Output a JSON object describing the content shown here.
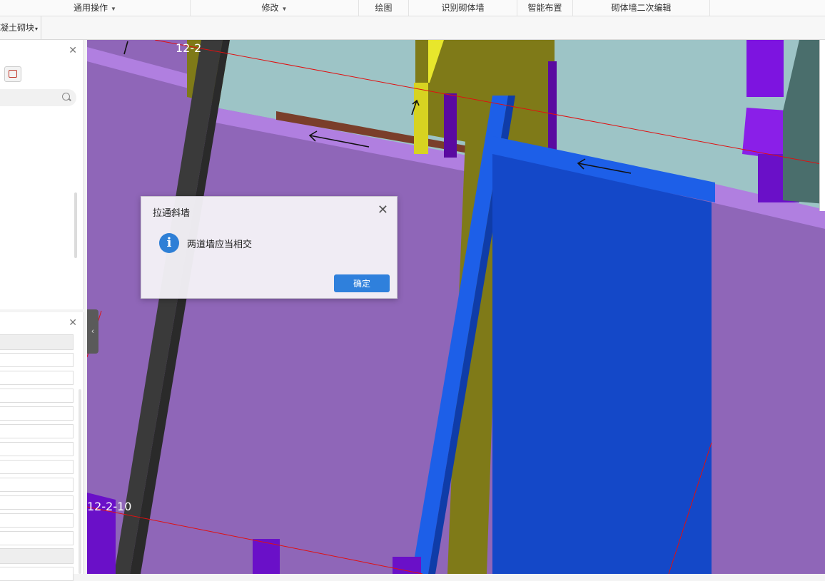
{
  "ribbon": {
    "groups": [
      {
        "label": "通用操作",
        "has_dropdown": true
      },
      {
        "label": "修改",
        "has_dropdown": true
      },
      {
        "label": "绘图",
        "has_dropdown": false
      },
      {
        "label": "识别砌体墙",
        "has_dropdown": false
      },
      {
        "label": "智能布置",
        "has_dropdown": false
      },
      {
        "label": "砌体墙二次编辑",
        "has_dropdown": false
      }
    ]
  },
  "toolbar": {
    "block_dropdown": "凝土砌块"
  },
  "viewport": {
    "axis_label_top": "12-2",
    "axis_label_bottom": "12-2-10"
  },
  "dialog": {
    "title": "拉通斜墙",
    "message": "两道墙应当相交",
    "ok_label": "确定"
  },
  "colors": {
    "wall_purple": "#8f66b8",
    "wall_blue": "#1448c8",
    "wall_olive": "#7f7a18",
    "floor_teal": "#9dc4c6",
    "accent_button": "#2f80dc"
  }
}
